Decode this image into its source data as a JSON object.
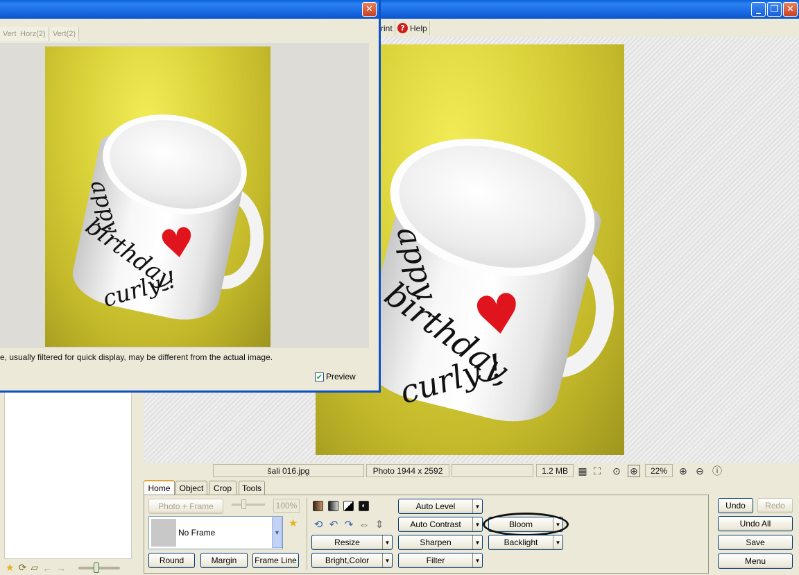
{
  "main_window": {
    "minimize_glyph": "_",
    "restore_glyph": "❐",
    "close_glyph": "✕"
  },
  "toolbar": {
    "print_partial": "rint",
    "help_label": "Help",
    "help_glyph": "?"
  },
  "status": {
    "filename": "šali 016.jpg",
    "dimensions": "Photo 1944 x 2592",
    "filesize": "1.2 MB",
    "zoom": "22%"
  },
  "tabs": [
    "Home",
    "Object",
    "Crop",
    "Tools"
  ],
  "frame": {
    "photo_frame_label": "Photo + Frame",
    "percent": "100%",
    "frame_value": "No Frame",
    "round_label": "Round",
    "margin_label": "Margin",
    "frame_line_label": "Frame Line"
  },
  "adjust": {
    "auto_level": "Auto Level",
    "auto_contrast": "Auto Contrast",
    "sharpen": "Sharpen",
    "filter": "Filter",
    "resize": "Resize",
    "bright_color": "Bright,Color",
    "bloom": "Bloom",
    "backlight": "Backlight"
  },
  "actions": {
    "undo": "Undo",
    "redo": "Redo",
    "undo_all": "Undo All",
    "save": "Save",
    "menu": "Menu"
  },
  "dialog": {
    "close_glyph": "✕",
    "tabs": [
      "Vert",
      "Horz(2)",
      "Vert(2)"
    ],
    "note": "e, usually filtered for quick display, may be different from the actual image.",
    "preview_label": "Preview",
    "preview_checked": true
  },
  "image_text": {
    "line1": "appy",
    "line2": "birthday,",
    "line3": "curly !",
    "heart": "♥"
  },
  "colors": {
    "accent": "#0b4ec5",
    "photo_bg": "#dcd43b",
    "heart": "#e0141c"
  }
}
